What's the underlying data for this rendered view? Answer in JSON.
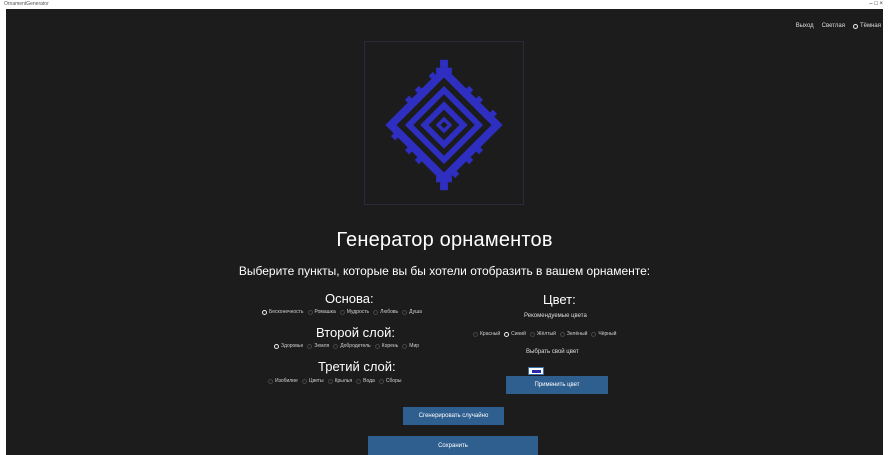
{
  "titlebar": {
    "title": "OrnamentGenerator",
    "controls": "– □ ×"
  },
  "topnav": {
    "items": [
      "Выход",
      "Светлая",
      "Тёмная"
    ],
    "theme_selected": "Тёмная"
  },
  "preview": {
    "ornament_color": "#2e2ec0",
    "background": "#1c1c1c"
  },
  "header": {
    "title": "Генератор орнаментов",
    "subtitle": "Выберите пункты, которые вы бы хотели отобразить в вашем орнаменте:"
  },
  "base": {
    "title": "Основа:",
    "options": [
      "Бесконечность",
      "Ромашка",
      "Мудрость",
      "Любовь",
      "Душа"
    ],
    "selected": 0
  },
  "layer2": {
    "title": "Второй слой:",
    "options": [
      "Здоровье",
      "Земля",
      "Добродетель",
      "Корень",
      "Мир"
    ],
    "selected": 0
  },
  "layer3": {
    "title": "Третий слой:",
    "options": [
      "Изобилие",
      "Цветы",
      "Крылья",
      "Вода",
      "Сборы"
    ],
    "selected": -1
  },
  "color": {
    "title": "Цвет:",
    "recommended_label": "Рекомендуемые цвета",
    "options": [
      "Красный",
      "Синий",
      "Жёлтый",
      "Зелёный",
      "Чёрный"
    ],
    "selected": 1,
    "custom_label": "Выбрать свой цвет",
    "custom_value": "#2b2ba8"
  },
  "buttons": {
    "apply_color": "Применить цвет",
    "generate_random": "Сгенерировать случайно",
    "save": "Сохранить"
  },
  "colors": {
    "button": "#2f5f8f",
    "app_bg": "#1c1c1c",
    "accent": "#2e2ec0"
  }
}
